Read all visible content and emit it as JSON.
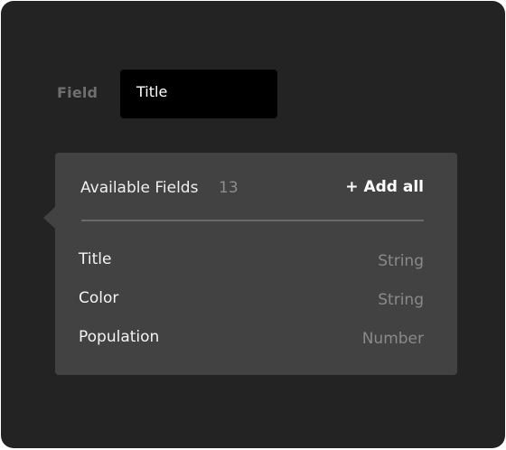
{
  "field": {
    "label": "Field",
    "value": "Title"
  },
  "available_fields": {
    "title": "Available Fields",
    "count": "13",
    "add_all_label": "+ Add all",
    "items": [
      {
        "name": "Title",
        "type": "String"
      },
      {
        "name": "Color",
        "type": "String"
      },
      {
        "name": "Population",
        "type": "Number"
      }
    ]
  }
}
